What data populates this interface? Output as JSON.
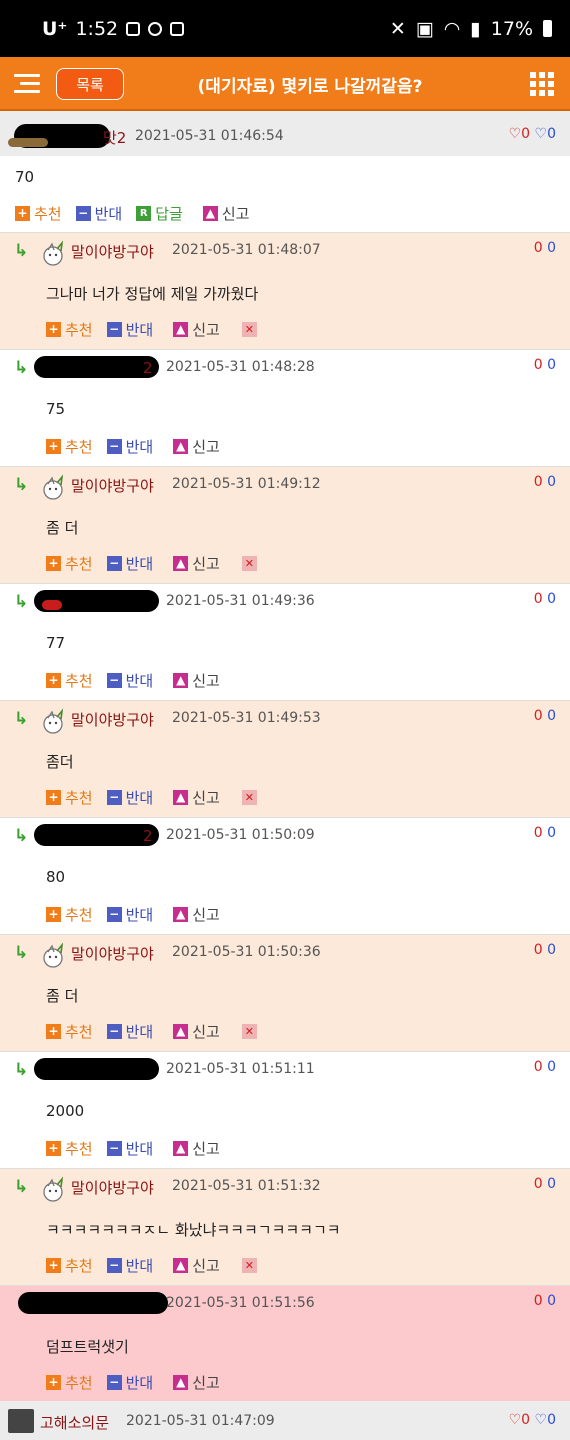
{
  "status_bar": {
    "carrier": "U⁺",
    "time": "1:52",
    "battery": "17%"
  },
  "header": {
    "list_button": "목록",
    "title": "(대기자료) 몇키로 나갈꺼같음?"
  },
  "labels": {
    "recommend": "추천",
    "oppose": "반대",
    "reply": "답글",
    "report": "신고"
  },
  "top_comment": {
    "author_suffix": "맛2",
    "time": "2021-05-31 01:46:54",
    "up": "0",
    "down": "0",
    "text": "70"
  },
  "replies": [
    {
      "author": "말이야방구야",
      "time": "2021-05-31 01:48:07",
      "up": "0",
      "down": "0",
      "text": "그나마 너가 정답에 제일 가까웠다"
    },
    {
      "author": "2",
      "time": "2021-05-31 01:48:28",
      "up": "0",
      "down": "0",
      "text": "75"
    },
    {
      "author": "말이야방구야",
      "time": "2021-05-31 01:49:12",
      "up": "0",
      "down": "0",
      "text": "좀 더"
    },
    {
      "author": "",
      "time": "2021-05-31 01:49:36",
      "up": "0",
      "down": "0",
      "text": "77"
    },
    {
      "author": "말이야방구야",
      "time": "2021-05-31 01:49:53",
      "up": "0",
      "down": "0",
      "text": "좀더"
    },
    {
      "author": "2",
      "time": "2021-05-31 01:50:09",
      "up": "0",
      "down": "0",
      "text": "80"
    },
    {
      "author": "말이야방구야",
      "time": "2021-05-31 01:50:36",
      "up": "0",
      "down": "0",
      "text": "좀 더"
    },
    {
      "author": "",
      "time": "2021-05-31 01:51:11",
      "up": "0",
      "down": "0",
      "text": "2000"
    },
    {
      "author": "말이야방구야",
      "time": "2021-05-31 01:51:32",
      "up": "0",
      "down": "0",
      "text": "ㅋㅋㅋㅋㅋㅋㅋㅈㄴ 화났냐ㅋㅋㅋㄱㅋㅋㅋㄱㅋ"
    },
    {
      "author": "",
      "time": "2021-05-31 01:51:56",
      "up": "0",
      "down": "0",
      "text": "덤프트럭샛기"
    }
  ],
  "footer_comment": {
    "author": "고해소의문",
    "time": "2021-05-31 01:47:09",
    "up": "0",
    "down": "0"
  }
}
